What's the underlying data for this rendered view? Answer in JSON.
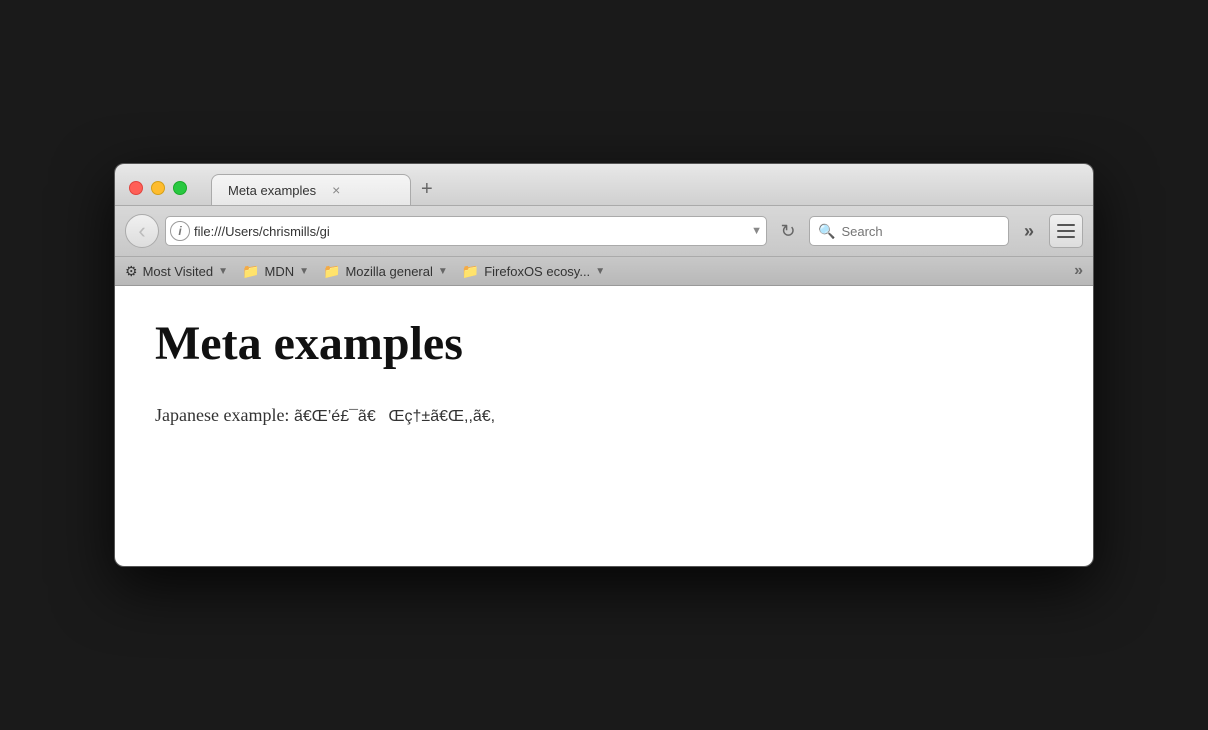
{
  "window": {
    "title": "Meta examples"
  },
  "controls": {
    "close_label": "",
    "minimize_label": "",
    "maximize_label": ""
  },
  "tab": {
    "title": "Meta examples",
    "close_icon": "×"
  },
  "new_tab_btn": "+",
  "toolbar": {
    "back_icon": "‹",
    "info_icon": "i",
    "address": "file:///Users/chrismills/gi‌",
    "dropdown_icon": "▼",
    "reload_icon": "↻",
    "search_placeholder": "Search",
    "overflow_icon": "»",
    "menu_icon": "≡"
  },
  "bookmarks": {
    "items": [
      {
        "icon": "⚙",
        "label": "Most Visited",
        "has_arrow": true
      },
      {
        "icon": "📁",
        "label": "MDN",
        "has_arrow": true
      },
      {
        "icon": "📁",
        "label": "Mozilla general",
        "has_arrow": true
      },
      {
        "icon": "📁",
        "label": "FirefoxOS ecosy...",
        "has_arrow": true
      }
    ],
    "overflow_icon": "»"
  },
  "page": {
    "heading": "Meta examples",
    "paragraph_label": "Japanese example: ",
    "garbled": "ã’é£¯ãŒç†±ã,,ã€,"
  }
}
